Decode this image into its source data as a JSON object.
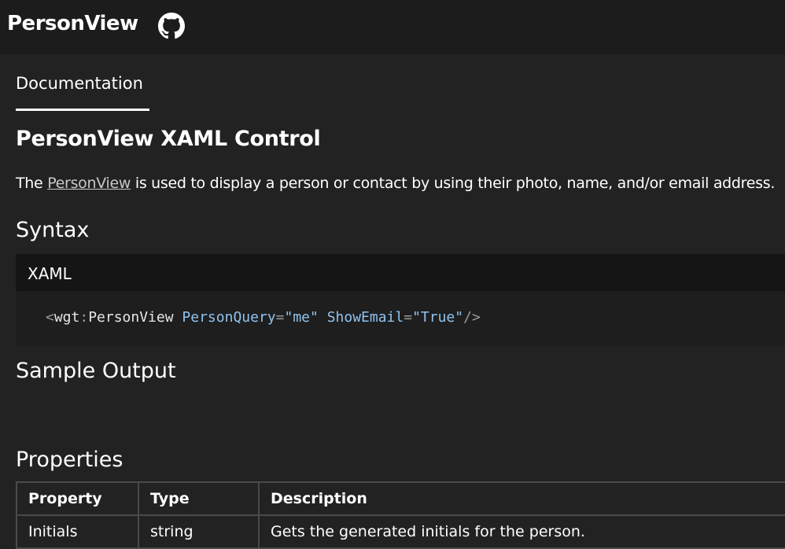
{
  "header": {
    "title": "PersonView",
    "github_icon": "github-icon"
  },
  "tabs": [
    {
      "label": "Documentation",
      "selected": true
    }
  ],
  "page": {
    "heading": "PersonView XAML Control",
    "intro_prefix": "The ",
    "intro_link": "PersonView",
    "intro_suffix": " is used to display a person or contact by using their photo, name, and/or email address."
  },
  "syntax": {
    "heading": "Syntax",
    "language": "XAML",
    "code": {
      "open": "<",
      "prefix": "wgt",
      "colon": ":",
      "tag": "PersonView",
      "attr1_name": "PersonQuery",
      "eq1": "=",
      "attr1_value": "\"me\"",
      "attr2_name": "ShowEmail",
      "eq2": "=",
      "attr2_value": "\"True\"",
      "close": "/>"
    }
  },
  "sample_output": {
    "heading": "Sample Output"
  },
  "properties": {
    "heading": "Properties",
    "columns": [
      "Property",
      "Type",
      "Description"
    ],
    "rows": [
      [
        "Initials",
        "string",
        "Gets the generated initials for the person."
      ]
    ]
  },
  "colors": {
    "background": "#222222",
    "titlebar": "#1c1c1c",
    "code_background": "#1e1e1e",
    "code_attribute": "#8fc3f0"
  }
}
